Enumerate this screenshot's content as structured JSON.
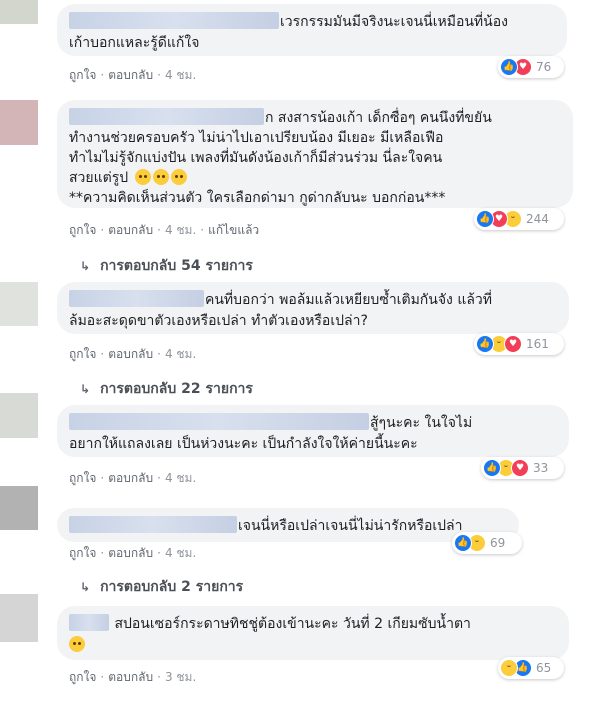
{
  "actions": {
    "like": "ถูกใจ",
    "reply": "ตอบกลับ",
    "sep": "·",
    "edited": "แก้ไขแล้ว"
  },
  "comments": [
    {
      "text": "เวรกรรมมันมีจริงนะเจนนี่เหมือนที่น้อง\nเก้าบอกแหละรู้ดีแก้ใจ",
      "time": "4 ชม.",
      "reaction_count": "76",
      "reactions": [
        "like-icon",
        "love-icon"
      ]
    },
    {
      "text": "ก สงสารน้องเก้า เด็กซื่อๆ คนนึงที่ขยัน\nทำงานช่วยครอบครัว ไม่น่าไปเอาเปรียบน้อง มีเยอะ มีเหลือเฟือ\nทำไมไม่รู้จักแบ่งปัน เพลงที่มันดังน้องเก้าก็มีส่วนร่วม นี่ละใจคน\nสวยแต่รูป",
      "note": "**ความคิดเห็นส่วนตัว ใครเลือกด่ามา กูด่ากลับนะ บอกก่อน***",
      "time": "4 ชม.",
      "reaction_count": "244",
      "reactions": [
        "like-icon",
        "love-icon",
        "haha-icon"
      ],
      "replies": "การตอบกลับ 54 รายการ"
    },
    {
      "text": "คนที่บอกว่า พอล้มแล้วเหยียบซ้ำเติมกันจัง แล้วที่\nล้มอะสะดุดขาตัวเองหรือเปล่า ทำตัวเองหรือเปล่า?",
      "time": "4 ชม.",
      "reaction_count": "161",
      "reactions": [
        "like-icon",
        "haha-icon",
        "love-icon"
      ],
      "replies": "การตอบกลับ 22 รายการ"
    },
    {
      "text": "สู้ๆนะคะ ในใจไม่\nอยากให้แถลงเลย เป็นห่วงนะคะ เป็นกำลังใจให้ค่ายนี้นะคะ",
      "time": "4 ชม.",
      "reaction_count": "33",
      "reactions": [
        "like-icon",
        "haha-icon",
        "love-icon"
      ]
    },
    {
      "text": "เจนนี่หรือเปล่าเจนนี่ไม่น่ารักหรือเปล่า",
      "time": "4 ชม.",
      "reaction_count": "69",
      "reactions": [
        "like-icon",
        "haha-icon"
      ],
      "replies": "การตอบกลับ 2 รายการ"
    },
    {
      "text": "สปอนเซอร์กระดาษทิชชู่ต้องเข้านะคะ วันที่ 2 เกียมซับน้ำตา",
      "time": "3 ชม.",
      "reaction_count": "65",
      "reactions": [
        "haha-icon",
        "like-icon"
      ]
    }
  ]
}
